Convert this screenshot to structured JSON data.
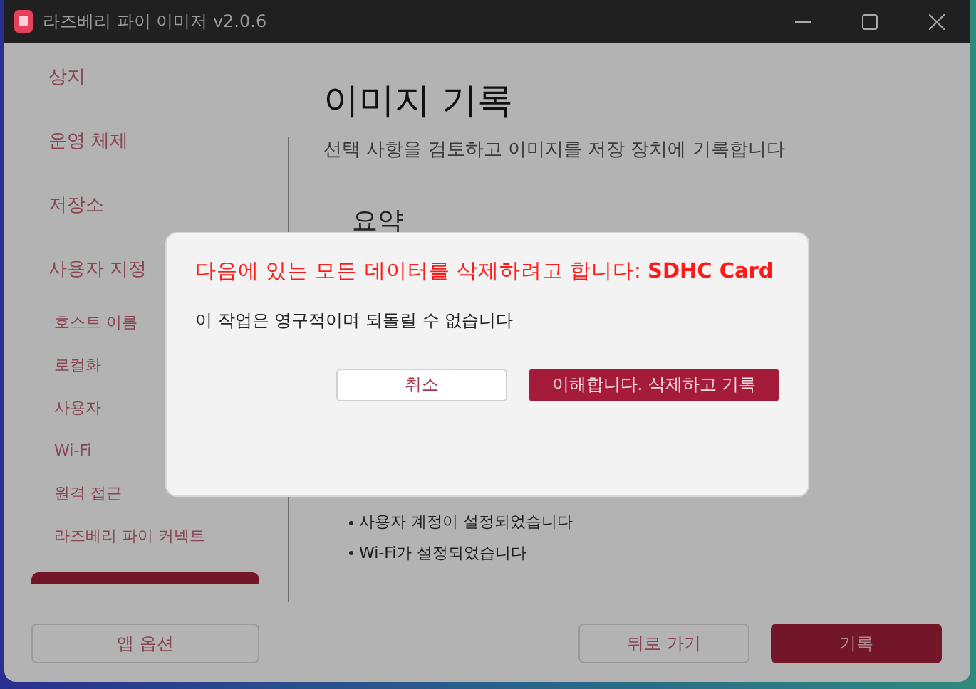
{
  "window": {
    "title": "라즈베리 파이 이미저 v2.0.6"
  },
  "sidebar": {
    "items": [
      {
        "label": "상지",
        "selected": false
      },
      {
        "label": "운영 체제",
        "selected": false
      },
      {
        "label": "저장소",
        "selected": false
      },
      {
        "label": "사용자 지정",
        "selected": false,
        "children": [
          {
            "label": "호스트 이름",
            "selected": false
          },
          {
            "label": "로컬화",
            "selected": false
          },
          {
            "label": "사용자",
            "selected": false
          },
          {
            "label": "Wi-Fi",
            "selected": false
          },
          {
            "label": "원격 접근",
            "selected": false
          },
          {
            "label": "라즈베리 파이 커넥트",
            "selected": false
          }
        ]
      },
      {
        "selected": true
      }
    ]
  },
  "page": {
    "title": "이미지 기록",
    "subtitle": "선택 사항을 검토하고 이미지를 저장 장치에 기록합니다",
    "summary_heading": "요약",
    "summary_items": [
      "사용자 계정이 설정되었습니다",
      "Wi-Fi가 설정되었습니다"
    ]
  },
  "footer": {
    "options_button": "앱 옵션",
    "back_button": "뒤로 가기",
    "write_button": "기록"
  },
  "dialog": {
    "title": "다음에 있는 모든 데이터를 삭제하려고 합니다: **SDHC Card**",
    "message": "이 작업은 영구적이며 되돌릴 수 없습니다",
    "cancel_button": "취소",
    "confirm_button": "이해합니다. 삭제하고 기록"
  }
}
